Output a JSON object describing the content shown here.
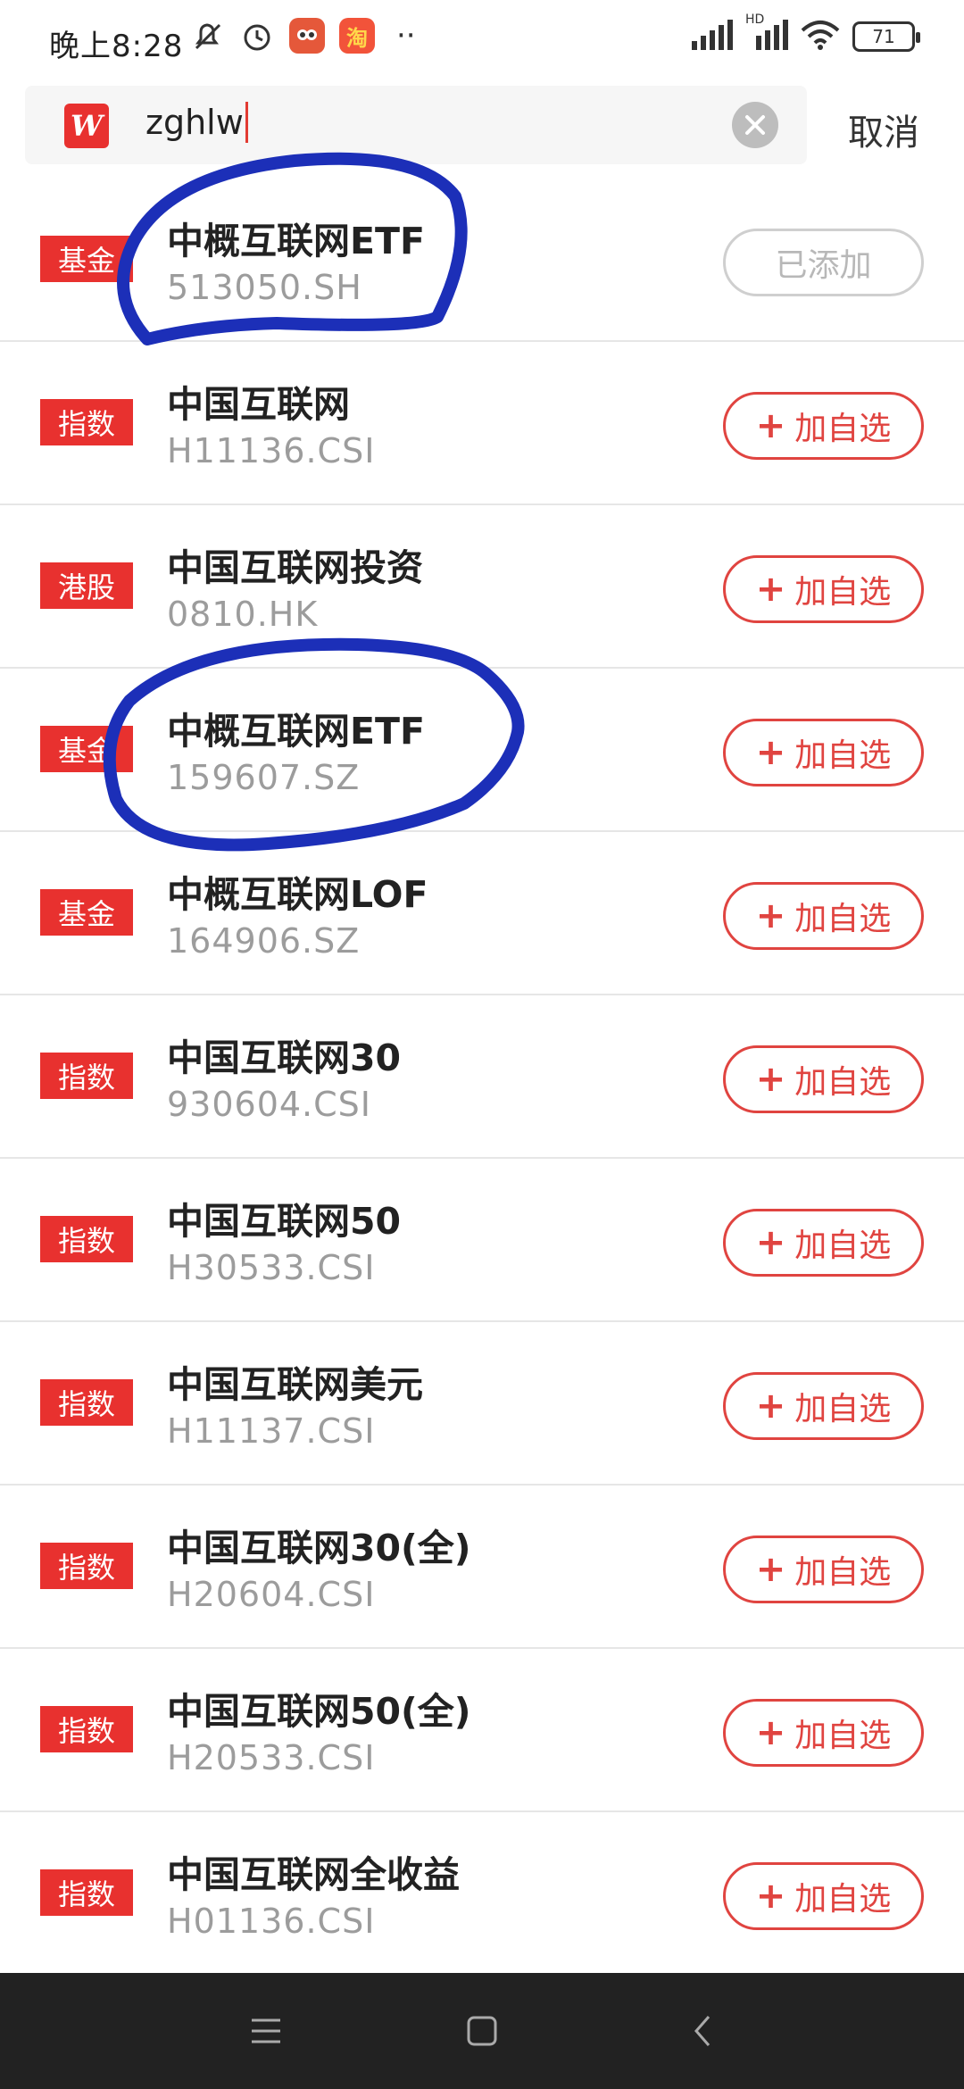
{
  "status_bar": {
    "time": "晚上8:28",
    "more": "··",
    "battery": "71",
    "network_label": "HD"
  },
  "search": {
    "query": "zghlw",
    "cancel_label": "取消",
    "logo_letter": "W"
  },
  "results": [
    {
      "tag": "基金",
      "name": "中概互联网ETF",
      "code": "513050.SH",
      "action": "已添加",
      "added": true
    },
    {
      "tag": "指数",
      "name": "中国互联网",
      "code": "H11136.CSI",
      "action": "加自选",
      "added": false
    },
    {
      "tag": "港股",
      "name": "中国互联网投资",
      "code": "0810.HK",
      "action": "加自选",
      "added": false
    },
    {
      "tag": "基金",
      "name": "中概互联网ETF",
      "code": "159607.SZ",
      "action": "加自选",
      "added": false
    },
    {
      "tag": "基金",
      "name": "中概互联网LOF",
      "code": "164906.SZ",
      "action": "加自选",
      "added": false
    },
    {
      "tag": "指数",
      "name": "中国互联网30",
      "code": "930604.CSI",
      "action": "加自选",
      "added": false
    },
    {
      "tag": "指数",
      "name": "中国互联网50",
      "code": "H30533.CSI",
      "action": "加自选",
      "added": false
    },
    {
      "tag": "指数",
      "name": "中国互联网美元",
      "code": "H11137.CSI",
      "action": "加自选",
      "added": false
    },
    {
      "tag": "指数",
      "name": "中国互联网30(全)",
      "code": "H20604.CSI",
      "action": "加自选",
      "added": false
    },
    {
      "tag": "指数",
      "name": "中国互联网50(全)",
      "code": "H20533.CSI",
      "action": "加自选",
      "added": false
    },
    {
      "tag": "指数",
      "name": "中国互联网全收益",
      "code": "H01136.CSI",
      "action": "加自选",
      "added": false
    }
  ],
  "colors": {
    "accent": "#e8312f",
    "annotation": "#1c2fb8"
  }
}
